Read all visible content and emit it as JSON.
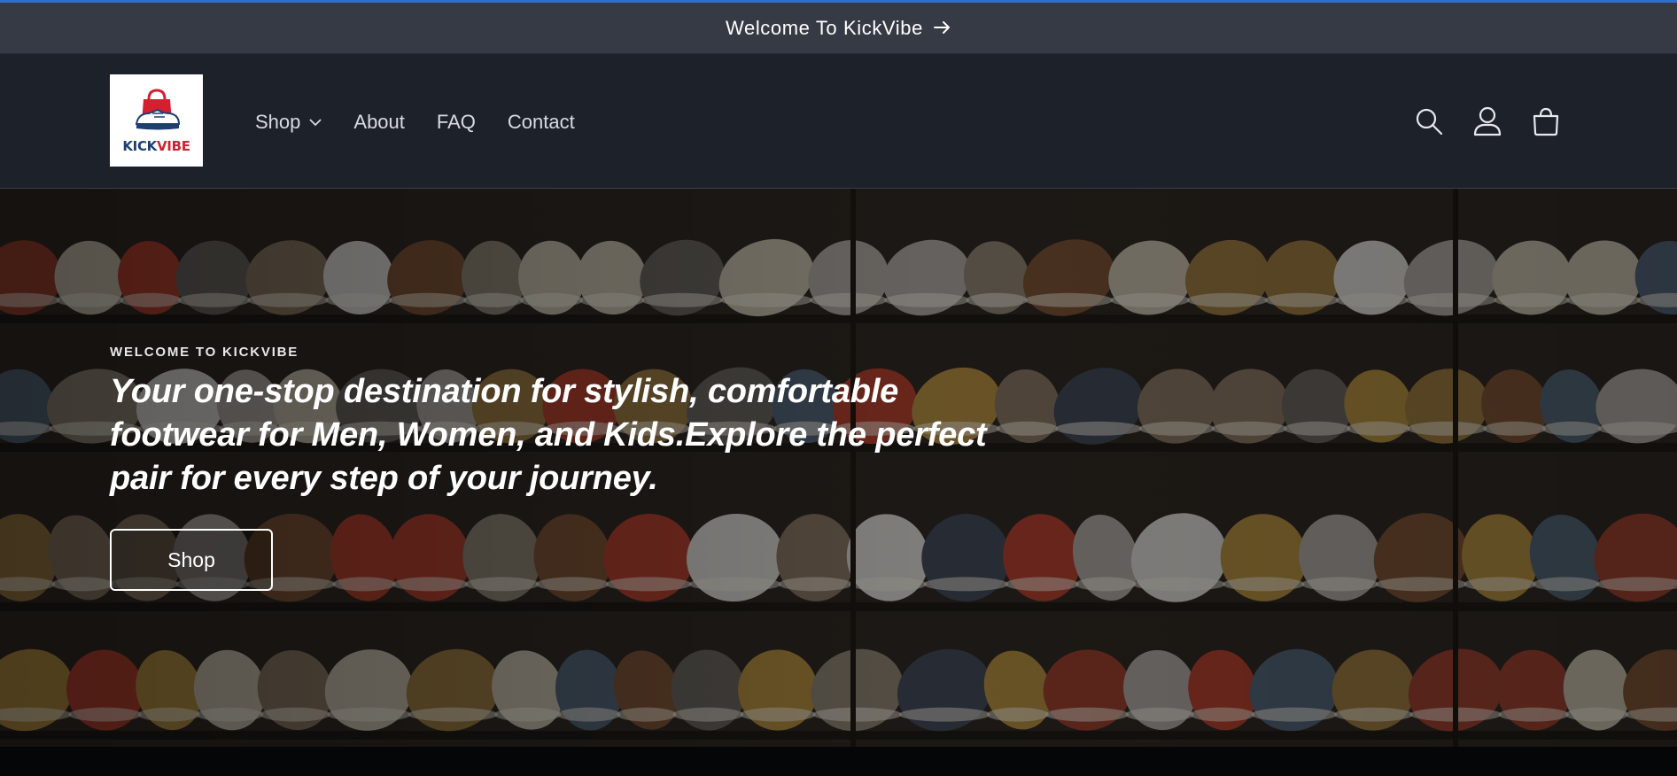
{
  "announcement": {
    "text": "Welcome To KickVibe",
    "arrow_icon": "arrow-right-icon"
  },
  "header": {
    "logo": {
      "word_kick": "KICK",
      "word_vibe": "VIBE",
      "icon": "shopping-bag-sneaker-icon"
    },
    "nav": [
      {
        "label": "Shop",
        "has_dropdown": true
      },
      {
        "label": "About"
      },
      {
        "label": "FAQ"
      },
      {
        "label": "Contact"
      }
    ],
    "icons": [
      "search-icon",
      "account-icon",
      "cart-icon"
    ]
  },
  "hero": {
    "eyebrow": "WELCOME TO KICKVIBE",
    "headline": "Your one-stop destination for stylish, comfortable footwear for Men, Women, and Kids.Explore the perfect pair for every step of your journey.",
    "button_label": "Shop",
    "background": "shoe-shelves-photo"
  },
  "colors": {
    "announcement_bg": "#353a44",
    "header_bg": "#1d222a",
    "accent_line": "#2f6fd1",
    "logo_blue": "#1d3f74",
    "logo_red": "#d32031"
  }
}
